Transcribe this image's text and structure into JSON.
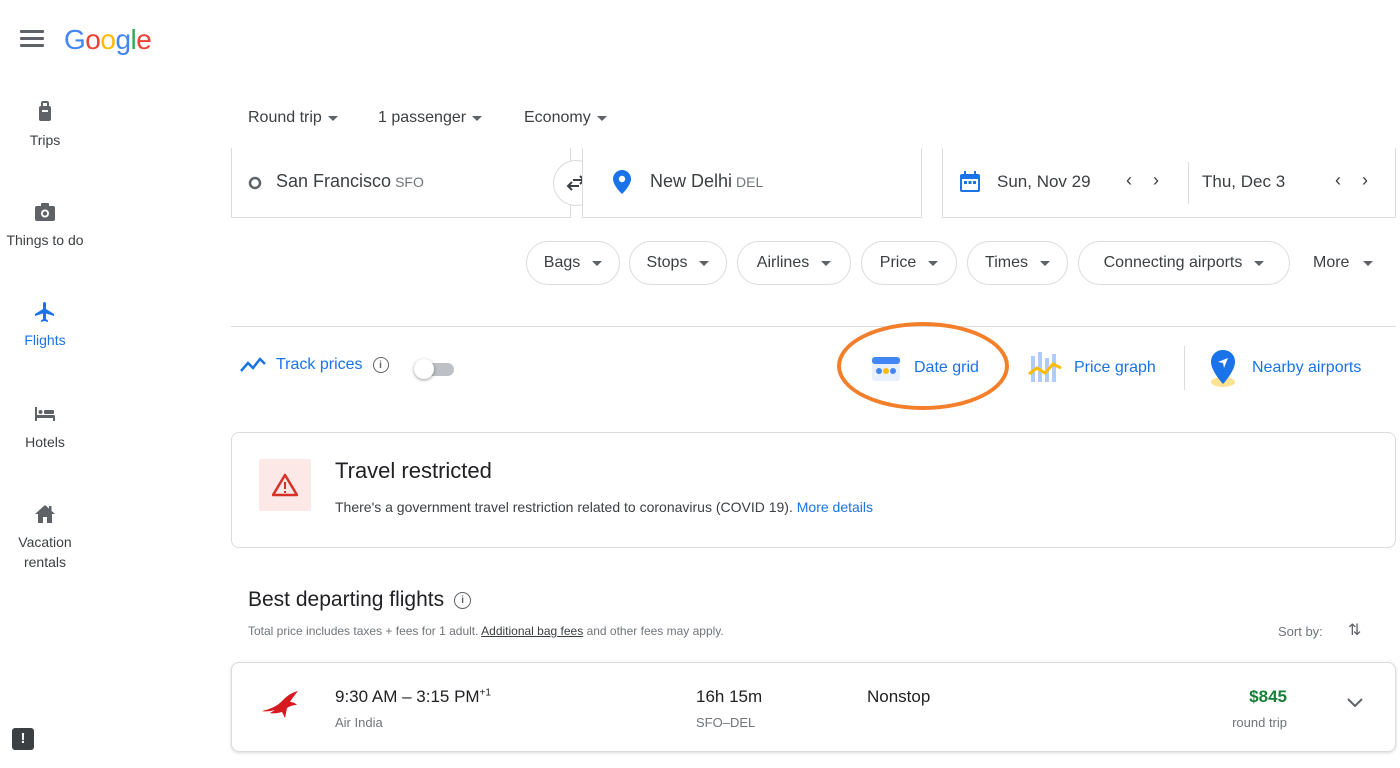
{
  "header": {
    "logo_letters": [
      {
        "ch": "G",
        "color": "#4285f4"
      },
      {
        "ch": "o",
        "color": "#ea4335"
      },
      {
        "ch": "o",
        "color": "#fbbc05"
      },
      {
        "ch": "g",
        "color": "#4285f4"
      },
      {
        "ch": "l",
        "color": "#34a853"
      },
      {
        "ch": "e",
        "color": "#ea4335"
      }
    ]
  },
  "sidebar": {
    "items": [
      {
        "label": "Trips",
        "icon": "luggage-icon"
      },
      {
        "label": "Things to do",
        "icon": "camera-icon"
      },
      {
        "label": "Flights",
        "icon": "airplane-icon",
        "active": true
      },
      {
        "label": "Hotels",
        "icon": "bed-icon"
      },
      {
        "label": "Vacation rentals",
        "icon": "house-icon"
      }
    ],
    "feedback_icon": "feedback-icon",
    "feedback_glyph": "!"
  },
  "trip_options": {
    "trip_type": "Round trip",
    "passengers": "1 passenger",
    "cabin": "Economy"
  },
  "search": {
    "origin_city": "San Francisco",
    "origin_code": "SFO",
    "destination_city": "New Delhi",
    "destination_code": "DEL",
    "depart_date": "Sun, Nov 29",
    "return_date": "Thu, Dec 3"
  },
  "filters": {
    "chips": [
      "Bags",
      "Stops",
      "Airlines",
      "Price",
      "Times",
      "Connecting airports"
    ],
    "more": "More"
  },
  "tools": {
    "track_prices": "Track prices",
    "track_enabled": false,
    "date_grid": "Date grid",
    "price_graph": "Price graph",
    "nearby_airports": "Nearby airports"
  },
  "alert": {
    "title": "Travel restricted",
    "text": "There's a government travel restriction related to coronavirus (COVID 19).",
    "link": "More details"
  },
  "results": {
    "title": "Best departing flights",
    "subtitle_before": "Total price includes taxes + fees for 1 adult.",
    "subtitle_link": "Additional bag fees",
    "subtitle_after": "and other fees may apply.",
    "sort_label": "Sort by:",
    "flights": [
      {
        "times": "9:30 AM – 3:15 PM",
        "day_offset": "+1",
        "airline": "Air India",
        "duration": "16h 15m",
        "route": "SFO–DEL",
        "stops": "Nonstop",
        "price": "$845",
        "price_type": "round trip"
      }
    ]
  },
  "colors": {
    "accent": "#1a73e8",
    "price_green": "#188038",
    "highlight_orange": "#f47f2a",
    "alert_red": "#d93025"
  }
}
